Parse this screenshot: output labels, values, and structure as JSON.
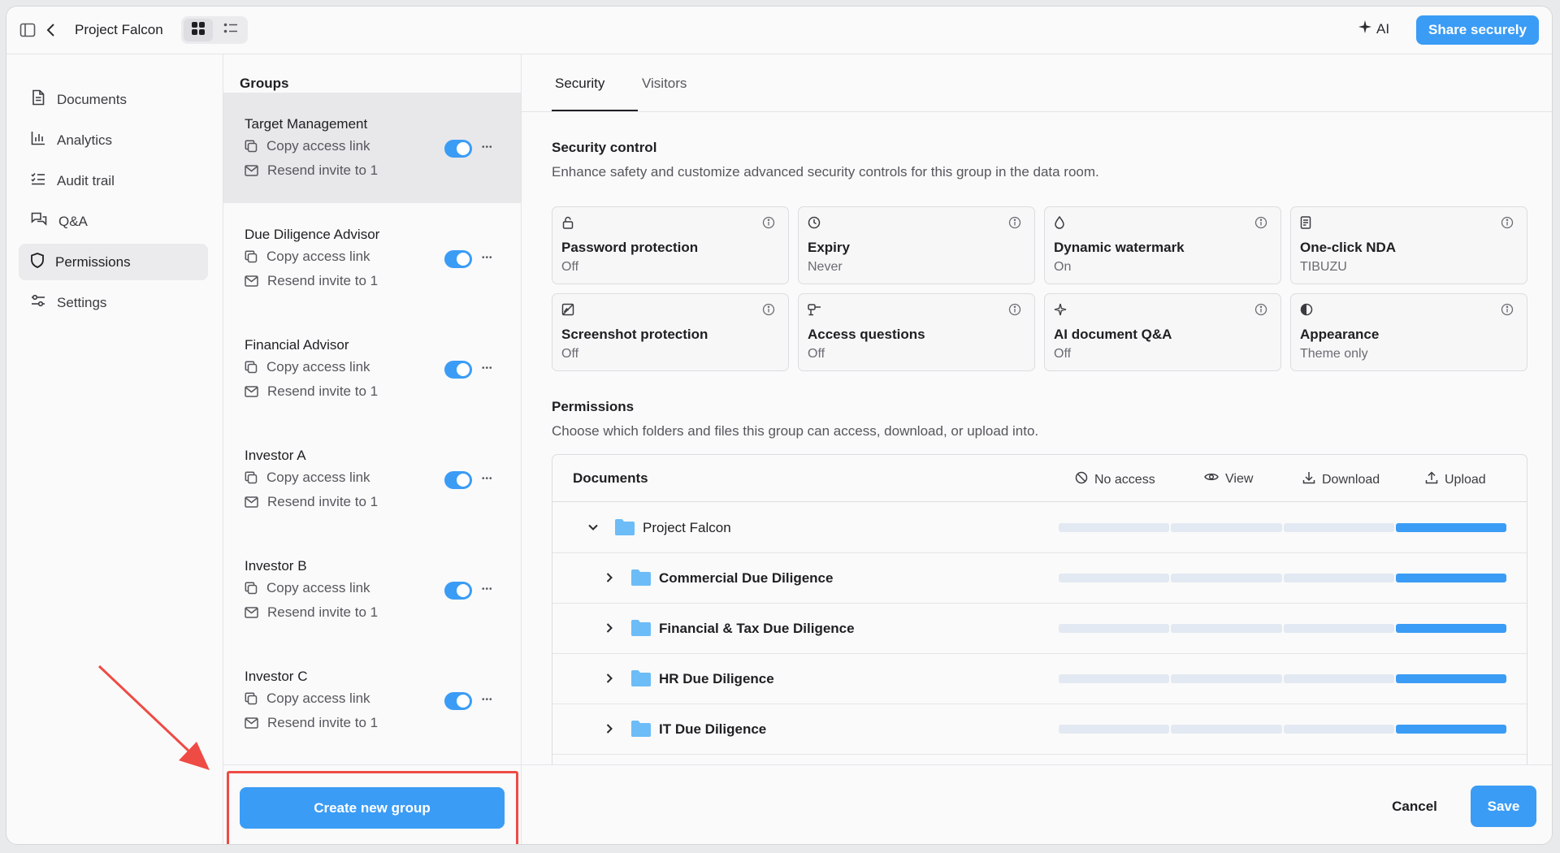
{
  "header": {
    "project_title": "Project Falcon",
    "ai_label": "AI",
    "share_label": "Share securely"
  },
  "nav": {
    "items": [
      {
        "label": "Documents",
        "icon": "document-icon"
      },
      {
        "label": "Analytics",
        "icon": "bar-chart-icon"
      },
      {
        "label": "Audit trail",
        "icon": "checklist-icon"
      },
      {
        "label": "Q&A",
        "icon": "chat-bubbles-icon"
      },
      {
        "label": "Permissions",
        "icon": "shield-icon",
        "active": true
      },
      {
        "label": "Settings",
        "icon": "sliders-icon"
      }
    ]
  },
  "groups": {
    "title": "Groups",
    "copy_label": "Copy access link",
    "resend_label": "Resend invite to 1",
    "items": [
      {
        "name": "Target Management",
        "enabled": true
      },
      {
        "name": "Due Diligence Advisor",
        "enabled": true
      },
      {
        "name": "Financial Advisor",
        "enabled": true
      },
      {
        "name": "Investor A",
        "enabled": true
      },
      {
        "name": "Investor B",
        "enabled": true
      },
      {
        "name": "Investor C",
        "enabled": true
      }
    ],
    "create_label": "Create new group"
  },
  "tabs": [
    "Security",
    "Visitors"
  ],
  "security": {
    "title": "Security control",
    "subtitle": "Enhance safety and customize advanced security controls for this group in the data room.",
    "cards": [
      {
        "title": "Password protection",
        "value": "Off",
        "icon": "lock-icon"
      },
      {
        "title": "Expiry",
        "value": "Never",
        "icon": "clock-icon"
      },
      {
        "title": "Dynamic watermark",
        "value": "On",
        "icon": "droplet-icon"
      },
      {
        "title": "One-click NDA",
        "value": "TIBUZU",
        "icon": "nda-document-icon"
      },
      {
        "title": "Screenshot protection",
        "value": "Off",
        "icon": "screenshot-off-icon"
      },
      {
        "title": "Access questions",
        "value": "Off",
        "icon": "question-scale-icon"
      },
      {
        "title": "AI document Q&A",
        "value": "Off",
        "icon": "sparkle-icon"
      },
      {
        "title": "Appearance",
        "value": "Theme only",
        "icon": "contrast-icon"
      }
    ]
  },
  "permissions": {
    "title": "Permissions",
    "subtitle": "Choose which folders and files this group can access, download, or upload into.",
    "columns": {
      "documents": "Documents",
      "no_access": "No access",
      "view": "View",
      "download": "Download",
      "upload": "Upload"
    },
    "rows": [
      {
        "name": "Project Falcon",
        "expanded": true,
        "level": "Upload"
      },
      {
        "name": "Commercial Due Diligence",
        "expanded": false,
        "level": "Upload"
      },
      {
        "name": "Financial & Tax Due Diligence",
        "expanded": false,
        "level": "Upload"
      },
      {
        "name": "HR Due Diligence",
        "expanded": false,
        "level": "Upload"
      },
      {
        "name": "IT Due Diligence",
        "expanded": false,
        "level": "Upload"
      }
    ]
  },
  "footer": {
    "cancel_label": "Cancel",
    "save_label": "Save"
  },
  "colors": {
    "accent": "#3b9cf5",
    "highlight": "#ee4b45",
    "folder": "#6cbcf7"
  }
}
